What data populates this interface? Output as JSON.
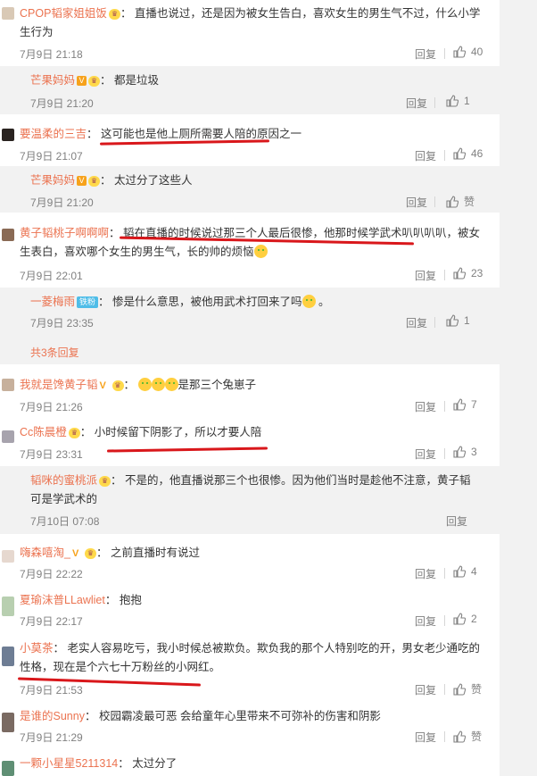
{
  "comments": [
    {
      "user": "CPOP韬家姐姐饭",
      "text": "直播也说过，还是因为被女生告白，喜欢女生的男生气不过，什么小学生行为",
      "time": "7月9日 21:18",
      "reply": "回复",
      "likes": "40"
    },
    {
      "user": "芒果妈妈",
      "text": "都是垃圾",
      "time": "7月9日 21:20",
      "reply": "回复",
      "likes": "1"
    },
    {
      "user": "要温柔的三吉",
      "text": "这可能也是他上厕所需要人陪的原因之一",
      "time": "7月9日 21:07",
      "reply": "回复",
      "likes": "46"
    },
    {
      "user": "芒果妈妈",
      "text": "太过分了这些人",
      "time": "7月9日 21:20",
      "reply": "回复",
      "likes": "赞"
    },
    {
      "user": "黄子韬桃子啊啊啊",
      "text": "韬在直播的时候说过那三个人最后很惨，他那时候学武术叭叭叭叭，被女生表白，喜欢哪个女生的男生气，长的帅的烦恼",
      "time": "7月9日 22:01",
      "reply": "回复",
      "likes": "23"
    },
    {
      "user": "一菱梅雨",
      "badge": "铁粉",
      "text": "惨是什么意思，被他用武术打回来了吗",
      "text_end": "。",
      "time": "7月9日 23:35",
      "reply": "回复",
      "likes": "1"
    },
    {
      "more": "共3条回复"
    },
    {
      "user": "我就是馋黄子韬",
      "text": "是那三个兔崽子",
      "time": "7月9日 21:26",
      "reply": "回复",
      "likes": "7"
    },
    {
      "user": "Cc陈晨橙",
      "text": "小时候留下阴影了，所以才要人陪",
      "time": "7月9日 23:31",
      "reply": "回复",
      "likes": "3"
    },
    {
      "user": "韬咪的蜜桃派",
      "text": "不是的，他直播说那三个也很惨。因为他们当时是趁他不注意，黄子韬可是学武术的",
      "time": "7月10日 07:08",
      "reply": "回复"
    },
    {
      "user": "嗨森嘻淘_",
      "text": "之前直播时有说过",
      "time": "7月9日 22:22",
      "reply": "回复",
      "likes": "4"
    },
    {
      "user": "夏瑜沫普LLawliet",
      "text": "抱抱",
      "time": "7月9日 22:17",
      "reply": "回复",
      "likes": "2"
    },
    {
      "user": "小莫茶",
      "text": "老实人容易吃亏，我小时候总被欺负。欺负我的那个人特别吃的开，男女老少通吃的性格，现在是个六七十万粉丝的小网红。",
      "time": "7月9日 21:53",
      "reply": "回复",
      "likes": "赞"
    },
    {
      "user": "是谁的Sunny",
      "text": "校园霸凌最可恶 会给童年心里带来不可弥补的伤害和阴影",
      "time": "7月9日 21:29",
      "reply": "回复",
      "likes": "赞"
    },
    {
      "user": "一颗小星星5211314",
      "text": "太过分了"
    }
  ]
}
